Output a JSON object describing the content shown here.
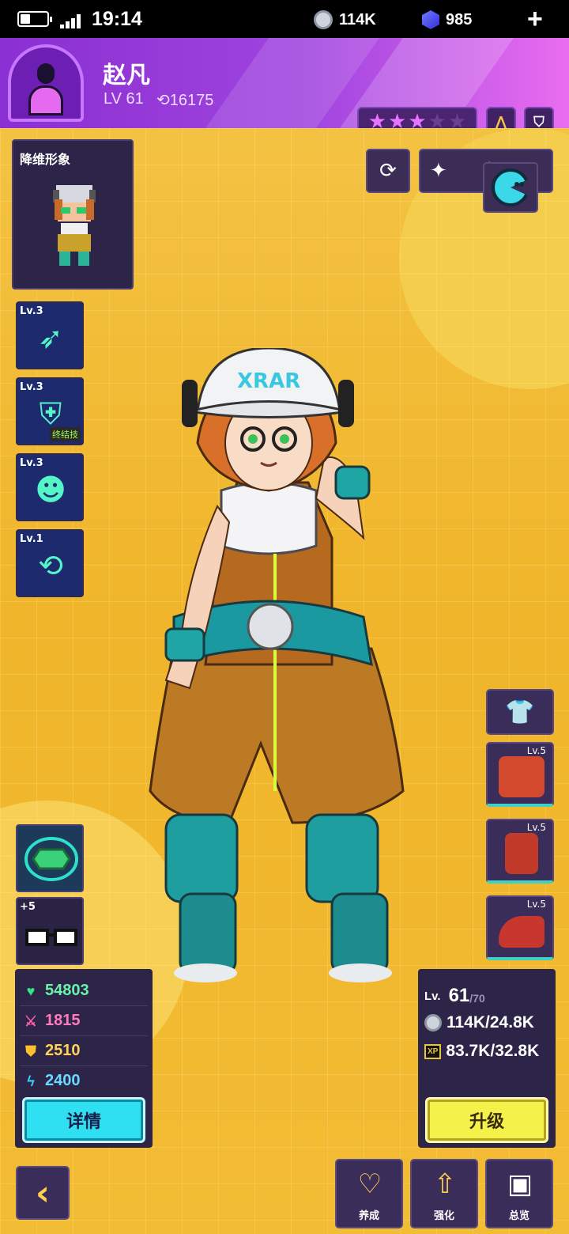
{
  "status_bar": {
    "time": "19:14",
    "coins": "114K",
    "gems": "985",
    "add_symbol": "+"
  },
  "player": {
    "name": "赵凡",
    "level": "LV 61",
    "power": "16175",
    "stars_filled": 3,
    "stars_total": 5
  },
  "pixel_card": {
    "title": "降维形象"
  },
  "skills": [
    {
      "level": "Lv.3",
      "icon": "feather-dart-icon",
      "tag": ""
    },
    {
      "level": "Lv.3",
      "icon": "shield-icon",
      "tag": "终结技"
    },
    {
      "level": "Lv.3",
      "icon": "robot-face-icon",
      "tag": ""
    },
    {
      "level": "Lv.1",
      "icon": "rocket-cycle-icon",
      "tag": ""
    }
  ],
  "equipment": [
    {
      "level": "Lv.5",
      "icon": "belt-armor-icon",
      "color": "#d3492e"
    },
    {
      "level": "Lv.5",
      "icon": "vest-icon",
      "color": "#c23a2a"
    },
    {
      "level": "Lv.5",
      "icon": "boot-icon",
      "color": "#c8372e"
    }
  ],
  "gear": [
    {
      "label": "",
      "icon": "green-gem-icon"
    },
    {
      "label": "+5",
      "icon": "glasses-icon"
    }
  ],
  "stats": {
    "hp": "54803",
    "attack": "1815",
    "defense": "2510",
    "speed": "2400",
    "details_label": "详情"
  },
  "level_panel": {
    "prefix": "Lv.",
    "level": "61",
    "max": "/70",
    "coin_cost": "114K/24.8K",
    "xp_cost": "83.7K/32.8K",
    "upgrade_label": "升级"
  },
  "bottom_nav": [
    {
      "label": "养成",
      "icon": "heart-icon"
    },
    {
      "label": "强化",
      "icon": "chip-upgrade-icon"
    },
    {
      "label": "总览",
      "icon": "folder-pulse-icon"
    }
  ],
  "colors": {
    "accent_purple": "#a145e0",
    "pink": "#e96df0",
    "cyan_button": "#2ee0f2",
    "yellow_button": "#f4f14a",
    "panel": "#2d2547"
  }
}
